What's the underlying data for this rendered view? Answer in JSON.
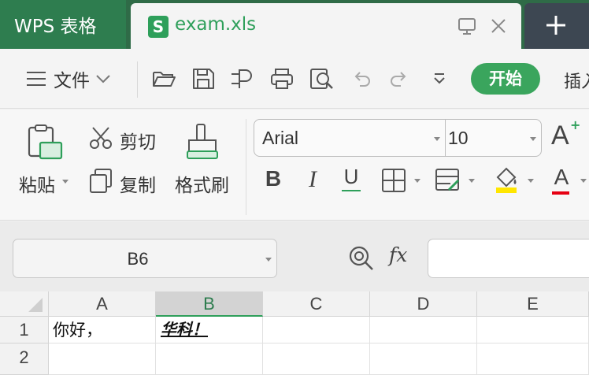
{
  "titlebar": {
    "app_tab": "WPS 表格",
    "doc_tab": "exam.xls",
    "doc_icon_letter": "S"
  },
  "menubar": {
    "file_label": "文件",
    "start_tab": "开始",
    "insert_tab": "插入"
  },
  "ribbon": {
    "paste_label": "粘贴",
    "cut_label": "剪切",
    "copy_label": "复制",
    "format_painter_label": "格式刷",
    "font_name": "Arial",
    "font_size": "10",
    "bold_glyph": "B",
    "italic_glyph": "I",
    "underline_glyph": "U",
    "font_color_glyph": "A",
    "grow_font_glyph": "A",
    "font_color": "#e60012",
    "fill_color": "#ffe600"
  },
  "formula_bar": {
    "cell_ref": "B6",
    "fx_label": "fx",
    "formula_value": ""
  },
  "sheet": {
    "columns": [
      "A",
      "B",
      "C",
      "D",
      "E"
    ],
    "active_column": "B",
    "rows": [
      "1",
      "2"
    ],
    "cells": {
      "A1": "你好，",
      "B1": "华科！"
    }
  },
  "colors": {
    "accent": "#2e9f5a",
    "titlebar": "#2f6b47",
    "start_button": "#3aa55d"
  }
}
